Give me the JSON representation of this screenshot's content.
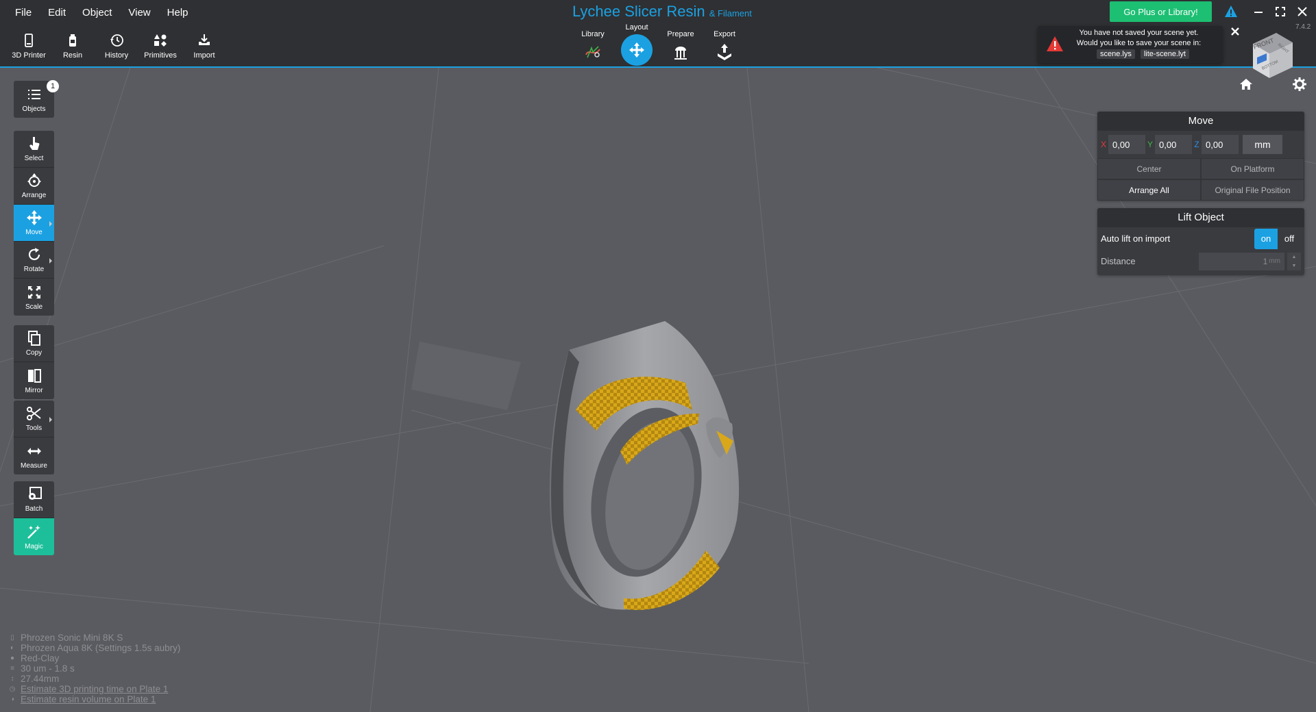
{
  "menu": [
    "File",
    "Edit",
    "Object",
    "View",
    "Help"
  ],
  "toolbar": [
    {
      "label": "3D Printer",
      "icon": "printer-icon"
    },
    {
      "label": "Resin",
      "icon": "resin-bottle-icon"
    },
    {
      "label": "History",
      "icon": "history-icon"
    },
    {
      "label": "Primitives",
      "icon": "shapes-icon"
    },
    {
      "label": "Import",
      "icon": "import-icon"
    }
  ],
  "app": {
    "title": "Lychee Slicer Resin",
    "subtitle": "& Filament",
    "version": "7.4.2"
  },
  "steps": {
    "library": "Library",
    "layout": "Layout",
    "prepare": "Prepare",
    "export": "Export",
    "active": "Layout"
  },
  "go_plus_label": "Go Plus or Library!",
  "notification": {
    "message": "You have not saved your scene yet. Would you like to save your scene in:",
    "options": [
      "scene.lys",
      "lite-scene.lyt"
    ]
  },
  "view_cube": {
    "front": "FRONT",
    "right": "RIGHT",
    "bottom": "BOTTOM"
  },
  "sidebar": {
    "objects": {
      "label": "Objects",
      "count": "1"
    },
    "select": "Select",
    "arrange": "Arrange",
    "move": "Move",
    "rotate": "Rotate",
    "scale": "Scale",
    "copy": "Copy",
    "mirror": "Mirror",
    "tools": "Tools",
    "measure": "Measure",
    "batch": "Batch",
    "magic": "Magic"
  },
  "move_panel": {
    "title": "Move",
    "x_label": "X",
    "x_value": "0,00",
    "y_label": "Y",
    "y_value": "0,00",
    "z_label": "Z",
    "z_value": "0,00",
    "unit": "mm",
    "center": "Center",
    "on_platform": "On Platform",
    "arrange_all": "Arrange All",
    "original_position": "Original File Position"
  },
  "lift_panel": {
    "title": "Lift Object",
    "auto_lift_label": "Auto lift on import",
    "on": "on",
    "off": "off",
    "auto_lift_state": "on",
    "distance_label": "Distance",
    "distance_value": "1",
    "distance_unit": "mm"
  },
  "info": {
    "printer": "Phrozen Sonic Mini 8K S",
    "resin": "Phrozen Aqua 8K (Settings 1.5s aubry)",
    "color": "Red-Clay",
    "layer": "30 um - 1.8 s",
    "height": "27.44mm",
    "estimate_time": "Estimate 3D printing time on Plate 1",
    "estimate_volume": "Estimate resin volume on Plate 1"
  },
  "colors": {
    "accent": "#1ba1e2",
    "go_plus": "#1dbf73",
    "magic": "#1dbf9a",
    "support": "#d8a81a",
    "warning": "#e53935"
  }
}
